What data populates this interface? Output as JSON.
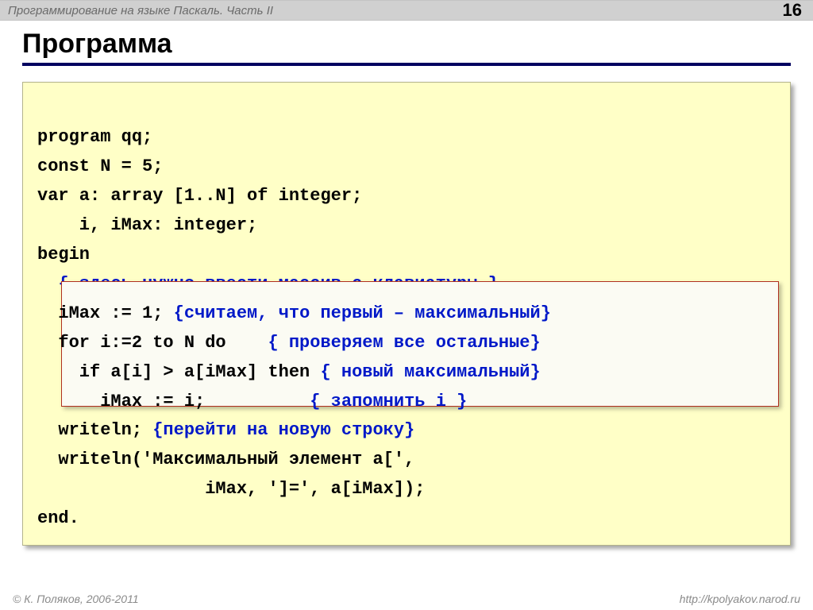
{
  "header": {
    "course": "Программирование на языке Паскаль. Часть II",
    "page": "16"
  },
  "title": "Программа",
  "code": {
    "l1": "program qq;",
    "l2": "const N = 5;",
    "l3": "var a: array [1..N] of integer;",
    "l4": "    i, iMax: integer;",
    "l5": "begin",
    "l6_pad": "  ",
    "l6_cmt": "{ здесь нужно ввести массив с клавиатуры }",
    "l7a": "  iMax := 1; ",
    "l7c": "{считаем, что первый – максимальный}",
    "l8a": "  for i:=2 to N do    ",
    "l8c": "{ проверяем все остальные}",
    "l9a": "    if a[i] > a[iMax] then ",
    "l9c": "{ новый максимальный}",
    "l10a": "      iMax := i;          ",
    "l10c": "{ запомнить i }",
    "l11a": "  writeln; ",
    "l11c": "{перейти на новую строку}",
    "l12": "  writeln('Максимальный элемент a[',",
    "l13": "                iMax, ']=', a[iMax]);",
    "l14": "end."
  },
  "footer": {
    "copyright": "© К. Поляков, 2006-2011",
    "url": "http://kpolyakov.narod.ru"
  }
}
